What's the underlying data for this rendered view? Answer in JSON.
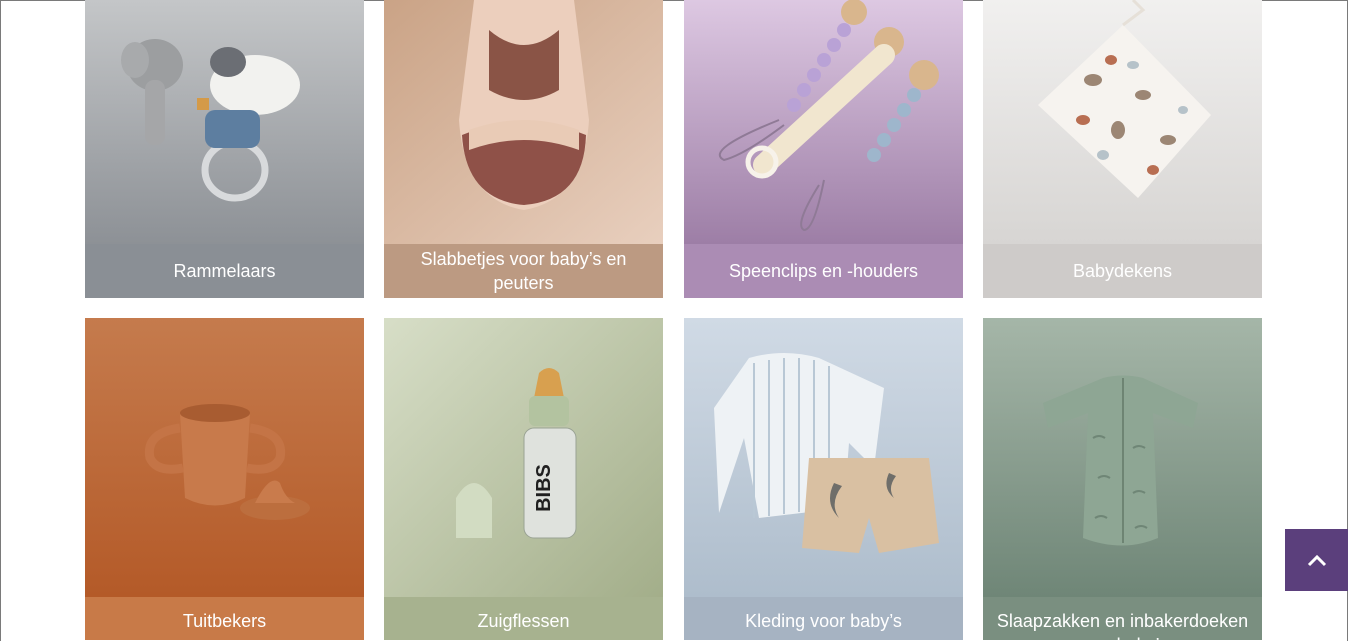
{
  "categories": [
    {
      "label": "Rammelaars",
      "icon": "rattle-icon",
      "bg": "#9a9ea2",
      "caption_bg": "#8a8f95"
    },
    {
      "label": "Slabbetjes voor baby’s en peuters",
      "icon": "bib-icon",
      "bg": "#d9b8a3",
      "caption_bg": "#bc9a82"
    },
    {
      "label": "Speenclips en -houders",
      "icon": "pacifier-clip-icon",
      "bg": "#bfa2c4",
      "caption_bg": "#ab8cb4"
    },
    {
      "label": "Babydekens",
      "icon": "blanket-icon",
      "bg": "#dedcdb",
      "caption_bg": "#cecbc9"
    },
    {
      "label": "Tuitbekers",
      "icon": "sippy-cup-icon",
      "bg": "#c87946",
      "caption_bg": "#c87a48"
    },
    {
      "label": "Zuigflessen",
      "icon": "baby-bottle-icon",
      "bg": "#b5c09e",
      "caption_bg": "#a7b28f"
    },
    {
      "label": "Kleding voor baby’s",
      "icon": "baby-clothing-icon",
      "bg": "#b8c6d6",
      "caption_bg": "#a6b3c2"
    },
    {
      "label": "Slaapzakken en inbakerdoeken voor baby’s",
      "icon": "sleeping-bag-icon",
      "bg": "#7d9385",
      "caption_bg": "#7a8f80"
    }
  ],
  "back_to_top": {
    "icon": "chevron-up-icon",
    "color": "#5b3f7c"
  }
}
